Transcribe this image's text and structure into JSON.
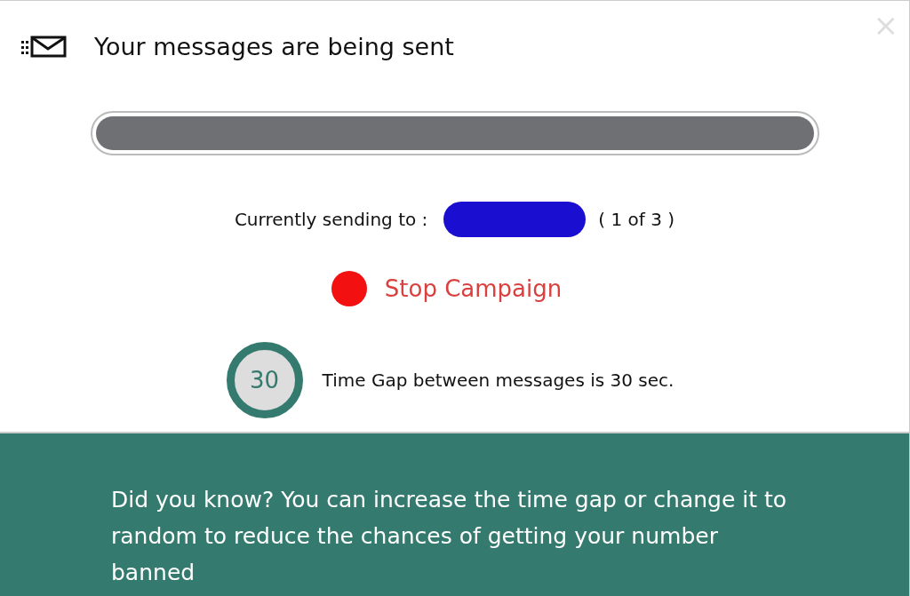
{
  "dialog": {
    "title": "Your messages are being sent",
    "close": "×"
  },
  "progress": {
    "level": 1
  },
  "status": {
    "label": "Currently sending to :",
    "recipient_redacted": true,
    "count": "( 1 of 3 )"
  },
  "stop_button": {
    "label": "Stop Campaign"
  },
  "timer": {
    "value": "30",
    "text": "Time Gap between messages is 30 sec."
  },
  "tip": {
    "text": "Did you know? You can increase the time gap or change it to random to reduce the chances of getting your number banned"
  }
}
